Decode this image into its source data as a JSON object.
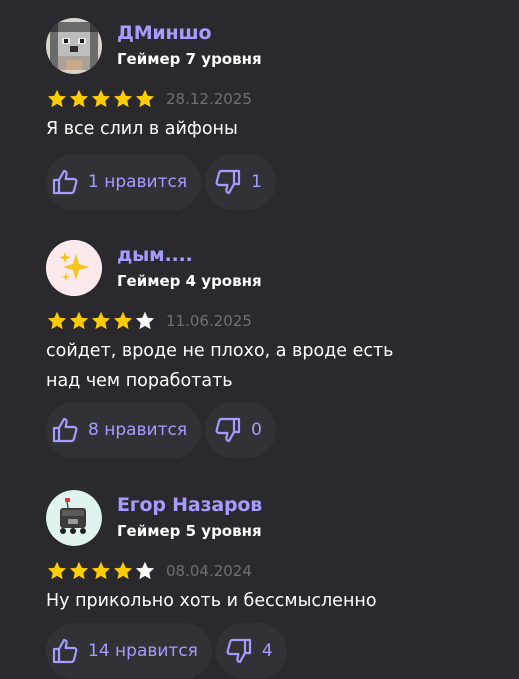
{
  "reviews": [
    {
      "author": "ДМиншо",
      "rank": "Геймер 7 уровня",
      "rating": 5,
      "date": "28.12.2025",
      "text": "Я все слил в айфоны",
      "likes_label": "1 нравится",
      "dislikes": "1",
      "avatar_icon": "pixel-husky-avatar"
    },
    {
      "author": "дым....",
      "rank": "Геймер 4 уровня",
      "rating": 4,
      "date": "11.06.2025",
      "text": "сойдет, вроде не плохо, а вроде есть\nнад чем поработать",
      "likes_label": "8 нравится",
      "dislikes": "0",
      "avatar_icon": "sparkles-avatar"
    },
    {
      "author": "Егор Назаров",
      "rank": "Геймер 5 уровня",
      "rating": 4,
      "date": "08.04.2024",
      "text": "Ну прикольно хоть и бессмысленно",
      "likes_label": "14 нравится",
      "dislikes": "4",
      "avatar_icon": "delivery-robot-avatar"
    }
  ],
  "colors": {
    "background": "#2a2a2e",
    "accent": "#a59cff",
    "star": "#ffcc00",
    "button": "#323236",
    "date": "#6f6f75"
  }
}
